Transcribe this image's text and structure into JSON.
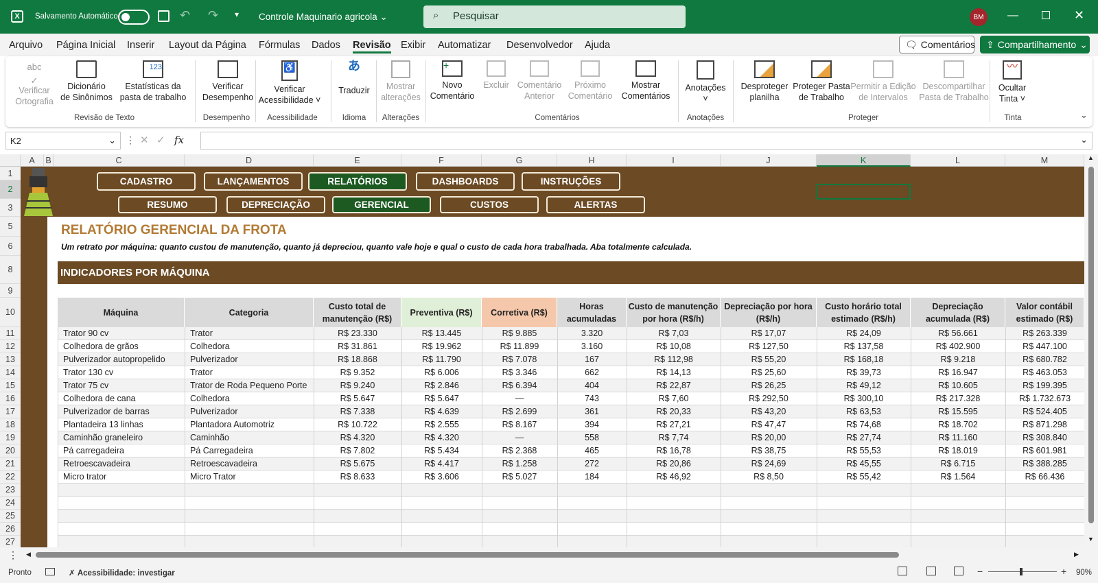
{
  "titlebar": {
    "autosave_label": "Salvamento Automático",
    "doc_title": "Controle Maquinario agricola",
    "search_placeholder": "Pesquisar",
    "user_initials": "BM",
    "accent": "#10793f"
  },
  "menu": {
    "items": [
      "Arquivo",
      "Página Inicial",
      "Inserir",
      "Layout da Página",
      "Fórmulas",
      "Dados",
      "Revisão",
      "Exibir",
      "Automatizar",
      "Desenvolvedor",
      "Ajuda"
    ],
    "active": "Revisão",
    "comments_label": "Comentários",
    "share_label": "Compartilhamento"
  },
  "ribbon": {
    "buttons": [
      {
        "label1": "Verificar",
        "label2": "Ortografia",
        "disabled": true,
        "icon": "spellcheck-icon"
      },
      {
        "label1": "Dicionário",
        "label2": "de Sinônimos",
        "disabled": false,
        "icon": "thesaurus-icon"
      },
      {
        "label1": "Estatísticas da",
        "label2": "pasta de trabalho",
        "disabled": false,
        "icon": "statistics-icon"
      },
      {
        "label1": "Verificar",
        "label2": "Desempenho",
        "disabled": false,
        "icon": "performance-icon"
      },
      {
        "label1": "Verificar",
        "label2": "Acessibilidade ˅",
        "disabled": false,
        "icon": "accessibility-icon"
      },
      {
        "label1": "Traduzir",
        "label2": "",
        "disabled": false,
        "icon": "translate-icon"
      },
      {
        "label1": "Mostrar",
        "label2": "alterações",
        "disabled": true,
        "icon": "show-changes-icon"
      },
      {
        "label1": "Novo",
        "label2": "Comentário",
        "disabled": false,
        "icon": "new-comment-icon"
      },
      {
        "label1": "Excluir",
        "label2": "",
        "disabled": true,
        "icon": "delete-comment-icon"
      },
      {
        "label1": "Comentário",
        "label2": "Anterior",
        "disabled": true,
        "icon": "previous-comment-icon"
      },
      {
        "label1": "Próximo",
        "label2": "Comentário",
        "disabled": true,
        "icon": "next-comment-icon"
      },
      {
        "label1": "Mostrar",
        "label2": "Comentários",
        "disabled": false,
        "icon": "show-comments-icon"
      },
      {
        "label1": "Anotações",
        "label2": "˅",
        "disabled": false,
        "icon": "notes-icon"
      },
      {
        "label1": "Desproteger",
        "label2": "planilha",
        "disabled": false,
        "icon": "unprotect-sheet-icon"
      },
      {
        "label1": "Proteger Pasta",
        "label2": "de Trabalho",
        "disabled": false,
        "icon": "protect-workbook-icon"
      },
      {
        "label1": "Permitir a Edição",
        "label2": "de Intervalos",
        "disabled": true,
        "icon": "allow-edit-ranges-icon"
      },
      {
        "label1": "Descompartilhar",
        "label2": "Pasta de Trabalho",
        "disabled": true,
        "icon": "unshare-workbook-icon"
      },
      {
        "label1": "Ocultar",
        "label2": "Tinta ˅",
        "disabled": false,
        "icon": "hide-ink-icon"
      }
    ],
    "groups": [
      "Revisão de Texto",
      "Desempenho",
      "Acessibilidade",
      "Idioma",
      "Alterações",
      "Comentários",
      "Anotações",
      "Proteger",
      "Tinta"
    ]
  },
  "formula_bar": {
    "name_box": "K2",
    "fx": "fx",
    "formula": ""
  },
  "columns": [
    "A",
    "B",
    "C",
    "D",
    "E",
    "F",
    "G",
    "H",
    "I",
    "J",
    "K",
    "L",
    "M"
  ],
  "selected_column": "K",
  "rows": [
    "1",
    "2",
    "3",
    "5",
    "6",
    "8",
    "9",
    "10",
    "11",
    "12",
    "13",
    "14",
    "15",
    "16",
    "17",
    "18",
    "19",
    "20",
    "21",
    "22",
    "23",
    "24",
    "25",
    "26",
    "27"
  ],
  "nav": {
    "top": [
      "CADASTRO",
      "LANÇAMENTOS",
      "RELATÓRIOS",
      "DASHBOARDS",
      "INSTRUÇÕES"
    ],
    "top_active": "RELATÓRIOS",
    "sub": [
      "RESUMO",
      "DEPRECIAÇÃO",
      "GERENCIAL",
      "CUSTOS",
      "ALERTAS"
    ],
    "sub_active": "GERENCIAL"
  },
  "report": {
    "title": "RELATÓRIO GERENCIAL DA FROTA",
    "subtitle": "Um retrato por máquina: quanto custou de manutenção, quanto já depreciou, quanto vale hoje e qual o custo de cada hora trabalhada. Aba totalmente calculada.",
    "section": "INDICADORES POR MÁQUINA",
    "headers": [
      [
        "Máquina",
        ""
      ],
      [
        "Categoria",
        ""
      ],
      [
        "Custo total de",
        "manutenção (R$)"
      ],
      [
        "Preventiva (R$)",
        ""
      ],
      [
        "Corretiva (R$)",
        ""
      ],
      [
        "Horas",
        "acumuladas"
      ],
      [
        "Custo de manutenção",
        "por hora (R$/h)"
      ],
      [
        "Depreciação por hora",
        "(R$/h)"
      ],
      [
        "Custo horário total",
        "estimado (R$/h)"
      ],
      [
        "Depreciação",
        "acumulada (R$)"
      ],
      [
        "Valor contábil",
        "estimado (R$)"
      ]
    ],
    "rows": [
      [
        "Trator 90 cv",
        "Trator",
        "R$ 23.330",
        "R$ 13.445",
        "R$ 9.885",
        "3.320",
        "R$ 7,03",
        "R$ 17,07",
        "R$ 24,09",
        "R$ 56.661",
        "R$ 263.339"
      ],
      [
        "Colhedora de grãos",
        "Colhedora",
        "R$ 31.861",
        "R$ 19.962",
        "R$ 11.899",
        "3.160",
        "R$ 10,08",
        "R$ 127,50",
        "R$ 137,58",
        "R$ 402.900",
        "R$ 447.100"
      ],
      [
        "Pulverizador autopropelido",
        "Pulverizador",
        "R$ 18.868",
        "R$ 11.790",
        "R$ 7.078",
        "167",
        "R$ 112,98",
        "R$ 55,20",
        "R$ 168,18",
        "R$ 9.218",
        "R$ 680.782"
      ],
      [
        "Trator 130 cv",
        "Trator",
        "R$ 9.352",
        "R$ 6.006",
        "R$ 3.346",
        "662",
        "R$ 14,13",
        "R$ 25,60",
        "R$ 39,73",
        "R$ 16.947",
        "R$ 463.053"
      ],
      [
        "Trator 75 cv",
        "Trator de Roda Pequeno Porte",
        "R$ 9.240",
        "R$ 2.846",
        "R$ 6.394",
        "404",
        "R$ 22,87",
        "R$ 26,25",
        "R$ 49,12",
        "R$ 10.605",
        "R$ 199.395"
      ],
      [
        "Colhedora de cana",
        "Colhedora",
        "R$ 5.647",
        "R$ 5.647",
        "—",
        "743",
        "R$ 7,60",
        "R$ 292,50",
        "R$ 300,10",
        "R$ 217.328",
        "R$ 1.732.673"
      ],
      [
        "Pulverizador de barras",
        "Pulverizador",
        "R$ 7.338",
        "R$ 4.639",
        "R$ 2.699",
        "361",
        "R$ 20,33",
        "R$ 43,20",
        "R$ 63,53",
        "R$ 15.595",
        "R$ 524.405"
      ],
      [
        "Plantadeira 13 linhas",
        "Plantadora Automotriz",
        "R$ 10.722",
        "R$ 2.555",
        "R$ 8.167",
        "394",
        "R$ 27,21",
        "R$ 47,47",
        "R$ 74,68",
        "R$ 18.702",
        "R$ 871.298"
      ],
      [
        "Caminhão graneleiro",
        "Caminhão",
        "R$ 4.320",
        "R$ 4.320",
        "—",
        "558",
        "R$ 7,74",
        "R$ 20,00",
        "R$ 27,74",
        "R$ 11.160",
        "R$ 308.840"
      ],
      [
        "Pá carregadeira",
        "Pá Carregadeira",
        "R$ 7.802",
        "R$ 5.434",
        "R$ 2.368",
        "465",
        "R$ 16,78",
        "R$ 38,75",
        "R$ 55,53",
        "R$ 18.019",
        "R$ 601.981"
      ],
      [
        "Retroescavadeira",
        "Retroescavadeira",
        "R$ 5.675",
        "R$ 4.417",
        "R$ 1.258",
        "272",
        "R$ 20,86",
        "R$ 24,69",
        "R$ 45,55",
        "R$ 6.715",
        "R$ 388.285"
      ],
      [
        "Micro trator",
        "Micro Trator",
        "R$ 8.633",
        "R$ 3.606",
        "R$ 5.027",
        "184",
        "R$ 46,92",
        "R$ 8,50",
        "R$ 55,42",
        "R$ 1.564",
        "R$ 66.436"
      ]
    ]
  },
  "statusbar": {
    "ready": "Pronto",
    "accessibility": "Acessibilidade: investigar",
    "zoom": "90%"
  }
}
